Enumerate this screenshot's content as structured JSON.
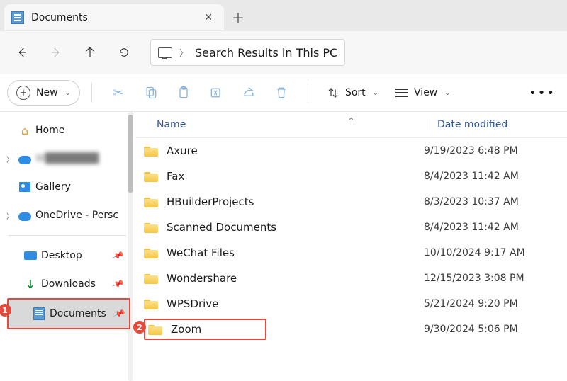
{
  "tab": {
    "title": "Documents"
  },
  "address": {
    "text": "Search Results in This PC"
  },
  "toolbar": {
    "new_label": "New",
    "sort_label": "Sort",
    "view_label": "View"
  },
  "sidebar": {
    "home": "Home",
    "account_blurred": "W███████",
    "gallery": "Gallery",
    "onedrive": "OneDrive - Persc",
    "desktop": "Desktop",
    "downloads": "Downloads",
    "documents": "Documents"
  },
  "columns": {
    "name": "Name",
    "date": "Date modified"
  },
  "rows": [
    {
      "name": "Axure",
      "date": "9/19/2023 6:48 PM"
    },
    {
      "name": "Fax",
      "date": "8/4/2023 11:42 AM"
    },
    {
      "name": "HBuilderProjects",
      "date": "8/3/2023 10:37 AM"
    },
    {
      "name": "Scanned Documents",
      "date": "8/4/2023 11:42 AM"
    },
    {
      "name": "WeChat Files",
      "date": "10/10/2024 9:17 AM"
    },
    {
      "name": "Wondershare",
      "date": "12/15/2023 3:08 PM"
    },
    {
      "name": "WPSDrive",
      "date": "5/21/2024 9:20 PM"
    },
    {
      "name": "Zoom",
      "date": "9/30/2024 5:06 PM"
    }
  ],
  "annotations": {
    "badge1": "1",
    "badge2": "2"
  }
}
